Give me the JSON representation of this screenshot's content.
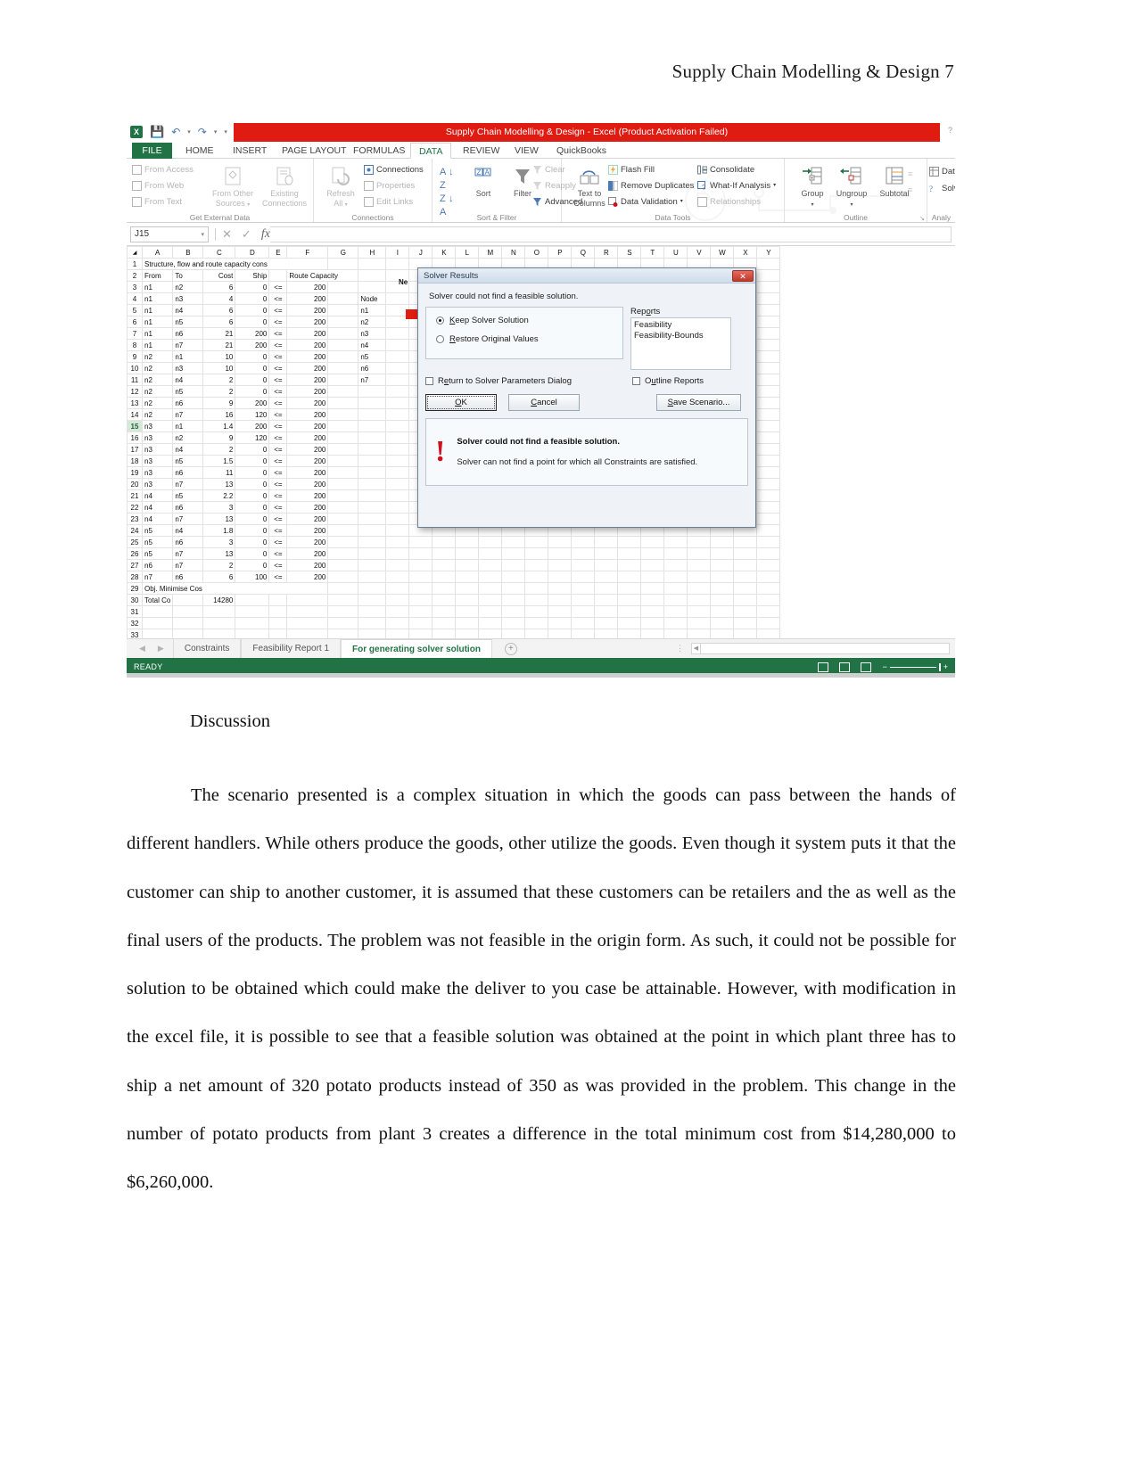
{
  "document": {
    "running_head": "Supply Chain Modelling & Design 7",
    "discussion_heading": "Discussion",
    "body_paragraph": "The scenario presented is a complex situation in which the goods can pass between the hands of different handlers. While others produce the goods, other utilize the goods. Even though it system puts it that the customer can ship to another customer, it is assumed that these customers can be retailers and the as well as the final users of the products. The problem was not feasible in the origin form. As such, it could not be possible for solution to be obtained which could make the deliver to you case be attainable.  However, with modification in the excel file, it is possible to see that a feasible solution was obtained at the point in which plant three has to ship a net amount of 320 potato products instead of 350 as was provided in the problem. This change in the number of potato products from plant 3 creates a difference in the total minimum cost from $14,280,000 to $6,260,000."
  },
  "excel": {
    "logo_text": "X",
    "title_bar": "Supply Chain Modelling & Design  -  Excel (Product Activation Failed)",
    "help_glyph": "?",
    "quick_access": [
      {
        "name": "save-icon",
        "glyph": "ὋE"
      },
      {
        "name": "undo-icon",
        "glyph": "↶"
      },
      {
        "name": "redo-icon",
        "glyph": "↷"
      },
      {
        "name": "customize-qat-icon",
        "glyph": "≡"
      }
    ],
    "ribbon_tabs": [
      {
        "label": "FILE",
        "active": false
      },
      {
        "label": "HOME",
        "active": false
      },
      {
        "label": "INSERT",
        "active": false
      },
      {
        "label": "PAGE LAYOUT",
        "active": false
      },
      {
        "label": "FORMULAS",
        "active": false
      },
      {
        "label": "DATA",
        "active": true
      },
      {
        "label": "REVIEW",
        "active": false
      },
      {
        "label": "VIEW",
        "active": false
      },
      {
        "label": "QuickBooks",
        "active": false
      }
    ],
    "ribbon_groups": {
      "get_external_data": {
        "label": "Get External Data",
        "small": [
          "From Access",
          "From Web",
          "From Text"
        ],
        "big": [
          "From Other Sources",
          "Existing Connections"
        ]
      },
      "connections": {
        "label": "Connections",
        "big": [
          "Refresh All"
        ],
        "small": [
          "Connections",
          "Properties",
          "Edit Links"
        ]
      },
      "sort_filter": {
        "label": "Sort & Filter",
        "big": [
          "Sort",
          "Filter"
        ],
        "small": [
          "Clear",
          "Reapply",
          "Advanced"
        ],
        "az_label": "A\nZ",
        "za_label": "Z\nA"
      },
      "data_tools": {
        "label": "Data Tools",
        "big": [
          "Text to Columns"
        ],
        "small": [
          "Flash Fill",
          "Remove Duplicates",
          "Data Validation",
          "Consolidate",
          "What-If Analysis",
          "Relationships"
        ]
      },
      "outline": {
        "label": "Outline",
        "big": [
          "Group",
          "Ungroup",
          "Subtotal"
        ],
        "dialog_launcher": "↘"
      },
      "analysis": {
        "label": "Analy",
        "small": [
          "Data A",
          "Solver"
        ]
      }
    },
    "formula_bar": {
      "name_box": "J15",
      "cancel_glyph": "✕",
      "enter_glyph": "✓",
      "function_glyph": "fx",
      "formula_value": ""
    },
    "grid": {
      "columns": [
        "A",
        "B",
        "C",
        "D",
        "E",
        "F",
        "G",
        "H",
        "I",
        "J",
        "K",
        "L",
        "M",
        "N",
        "O",
        "P",
        "Q",
        "R",
        "S",
        "T",
        "U",
        "V",
        "W",
        "X",
        "Y"
      ],
      "selected_row": 15,
      "rows": [
        {
          "n": "1",
          "A": "Structure, flow and route capacity cons",
          "merged": true
        },
        {
          "n": "2",
          "A": "From",
          "B": "To",
          "C": "Cost",
          "D": "Ship",
          "E": "",
          "F": "Route Capacity",
          "F_merged": true
        },
        {
          "n": "3",
          "A": "n1",
          "B": "n2",
          "C": "6",
          "D": "0",
          "E": "<=",
          "F": "200",
          "H": ""
        },
        {
          "n": "4",
          "A": "n1",
          "B": "n3",
          "C": "4",
          "D": "0",
          "E": "<=",
          "F": "200",
          "H": "Node",
          "Hbold": true
        },
        {
          "n": "5",
          "A": "n1",
          "B": "n4",
          "C": "6",
          "D": "0",
          "E": "<=",
          "F": "200",
          "H": "n1"
        },
        {
          "n": "6",
          "A": "n1",
          "B": "n5",
          "C": "6",
          "D": "0",
          "E": "<=",
          "F": "200",
          "H": "n2"
        },
        {
          "n": "7",
          "A": "n1",
          "B": "n6",
          "C": "21",
          "D": "200",
          "E": "<=",
          "F": "200",
          "H": "n3"
        },
        {
          "n": "8",
          "A": "n1",
          "B": "n7",
          "C": "21",
          "D": "200",
          "E": "<=",
          "F": "200",
          "H": "n4"
        },
        {
          "n": "9",
          "A": "n2",
          "B": "n1",
          "C": "10",
          "D": "0",
          "E": "<=",
          "F": "200",
          "H": "n5"
        },
        {
          "n": "10",
          "A": "n2",
          "B": "n3",
          "C": "10",
          "D": "0",
          "E": "<=",
          "F": "200",
          "H": "n6"
        },
        {
          "n": "11",
          "A": "n2",
          "B": "n4",
          "C": "2",
          "D": "0",
          "E": "<=",
          "F": "200",
          "H": "n7"
        },
        {
          "n": "12",
          "A": "n2",
          "B": "n5",
          "C": "2",
          "D": "0",
          "E": "<=",
          "F": "200",
          "H": ""
        },
        {
          "n": "13",
          "A": "n2",
          "B": "n6",
          "C": "9",
          "D": "200",
          "E": "<=",
          "F": "200",
          "H": ""
        },
        {
          "n": "14",
          "A": "n2",
          "B": "n7",
          "C": "16",
          "D": "120",
          "E": "<=",
          "F": "200",
          "H": ""
        },
        {
          "n": "15",
          "A": "n3",
          "B": "n1",
          "C": "1.4",
          "D": "200",
          "E": "<=",
          "F": "200",
          "H": ""
        },
        {
          "n": "16",
          "A": "n3",
          "B": "n2",
          "C": "9",
          "D": "120",
          "E": "<=",
          "F": "200",
          "H": ""
        },
        {
          "n": "17",
          "A": "n3",
          "B": "n4",
          "C": "2",
          "D": "0",
          "E": "<=",
          "F": "200",
          "H": ""
        },
        {
          "n": "18",
          "A": "n3",
          "B": "n5",
          "C": "1.5",
          "D": "0",
          "E": "<=",
          "F": "200",
          "H": ""
        },
        {
          "n": "19",
          "A": "n3",
          "B": "n6",
          "C": "11",
          "D": "0",
          "E": "<=",
          "F": "200",
          "H": ""
        },
        {
          "n": "20",
          "A": "n3",
          "B": "n7",
          "C": "13",
          "D": "0",
          "E": "<=",
          "F": "200",
          "H": ""
        },
        {
          "n": "21",
          "A": "n4",
          "B": "n5",
          "C": "2.2",
          "D": "0",
          "E": "<=",
          "F": "200",
          "H": ""
        },
        {
          "n": "22",
          "A": "n4",
          "B": "n6",
          "C": "3",
          "D": "0",
          "E": "<=",
          "F": "200",
          "H": ""
        },
        {
          "n": "23",
          "A": "n4",
          "B": "n7",
          "C": "13",
          "D": "0",
          "E": "<=",
          "F": "200",
          "H": ""
        },
        {
          "n": "24",
          "A": "n5",
          "B": "n4",
          "C": "1.8",
          "D": "0",
          "E": "<=",
          "F": "200",
          "H": ""
        },
        {
          "n": "25",
          "A": "n5",
          "B": "n6",
          "C": "3",
          "D": "0",
          "E": "<=",
          "F": "200",
          "H": ""
        },
        {
          "n": "26",
          "A": "n5",
          "B": "n7",
          "C": "13",
          "D": "0",
          "E": "<=",
          "F": "200",
          "H": ""
        },
        {
          "n": "27",
          "A": "n6",
          "B": "n7",
          "C": "2",
          "D": "0",
          "E": "<=",
          "F": "200",
          "H": ""
        },
        {
          "n": "28",
          "A": "n7",
          "B": "n6",
          "C": "6",
          "D": "100",
          "E": "<=",
          "F": "200",
          "H": ""
        },
        {
          "n": "29",
          "A": "Obj. Minimise Cos",
          "bold": true,
          "merged": true
        },
        {
          "n": "30",
          "A": "Total Co",
          "C": "14280",
          "bold": true
        },
        {
          "n": "31"
        },
        {
          "n": "32"
        },
        {
          "n": "33"
        }
      ],
      "node_header": "Ne"
    },
    "sheet_tabs": [
      {
        "label": "Constraints",
        "active": false
      },
      {
        "label": "Feasibility Report 1",
        "active": false
      },
      {
        "label": "For generating solver solution",
        "active": true
      }
    ],
    "add_sheet_glyph": "⊕",
    "status_bar": {
      "ready": "READY",
      "views": [
        "normal-view",
        "page-layout-view",
        "page-break-view"
      ],
      "zoom_minus": "−",
      "zoom_plus": "+"
    }
  },
  "solver_dialog": {
    "title": "Solver Results",
    "close_glyph": "✕",
    "message": "Solver could not find a feasible solution.",
    "options": [
      {
        "label_pre": "K",
        "label_post": "eep Solver Solution",
        "selected": true
      },
      {
        "label_pre": "R",
        "label_post": "estore Original Values",
        "selected": false
      }
    ],
    "reports_label_pre": "Rep",
    "reports_label_post": "orts",
    "reports": [
      "Feasibility",
      "Feasibility-Bounds"
    ],
    "return_checkbox": {
      "pre": "R",
      "mid": "e",
      "post": "turn to Solver Parameters Dialog",
      "checked": false
    },
    "outline_checkbox": {
      "pre": "O",
      "mid": "u",
      "post": "tline Reports",
      "checked": false
    },
    "buttons": [
      {
        "name": "ok-button",
        "label": "OK",
        "underline_index": 0,
        "default": true
      },
      {
        "name": "cancel-button",
        "label": "Cancel",
        "underline_index": 0,
        "default": false
      },
      {
        "name": "save-scenario-button",
        "label": "Save Scenario...",
        "underline_index": 0,
        "default": false
      }
    ],
    "warning_title": "Solver could not find a feasible solution.",
    "warning_text": "Solver can not find a point for which all Constraints are satisfied.",
    "warning_glyph": "!"
  },
  "colors": {
    "excel_green": "#217346",
    "title_red": "#e01b12",
    "tab_active_text": "#217346"
  }
}
